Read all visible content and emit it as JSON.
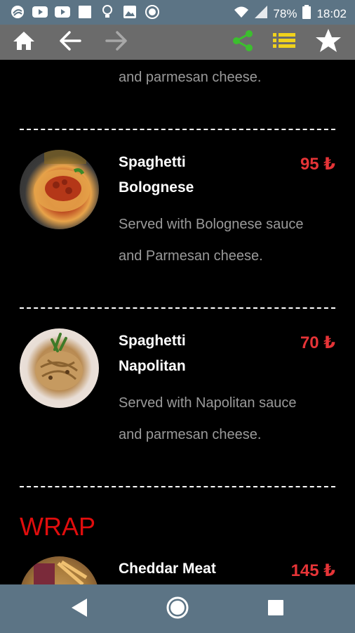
{
  "status_bar": {
    "battery": "78%",
    "time": "18:02"
  },
  "toolbar": {
    "home_icon": "home-icon",
    "back_icon": "arrow-left-icon",
    "forward_icon": "arrow-right-icon",
    "share_icon": "share-icon",
    "list_icon": "list-icon",
    "favorite_icon": "star-icon"
  },
  "menu": {
    "partial_description": "and parmesan cheese.",
    "items": [
      {
        "name_line1": "Spaghetti",
        "name_line2": "Bolognese",
        "price": "95 ₺",
        "desc_line1": "Served with Bolognese sauce",
        "desc_line2": "and Parmesan cheese."
      },
      {
        "name_line1": "Spaghetti",
        "name_line2": "Napolitan",
        "price": "70 ₺",
        "desc_line1": "Served with Napolitan sauce",
        "desc_line2": "and parmesan cheese."
      }
    ],
    "section": {
      "title": "WRAP",
      "first_item_name": "Cheddar Meat",
      "first_item_price": "145 ₺"
    }
  },
  "colors": {
    "accent_price": "#e63437",
    "section_title": "#e00d0d",
    "share_green": "#3cbf2e",
    "list_yellow": "#f0d21c"
  }
}
